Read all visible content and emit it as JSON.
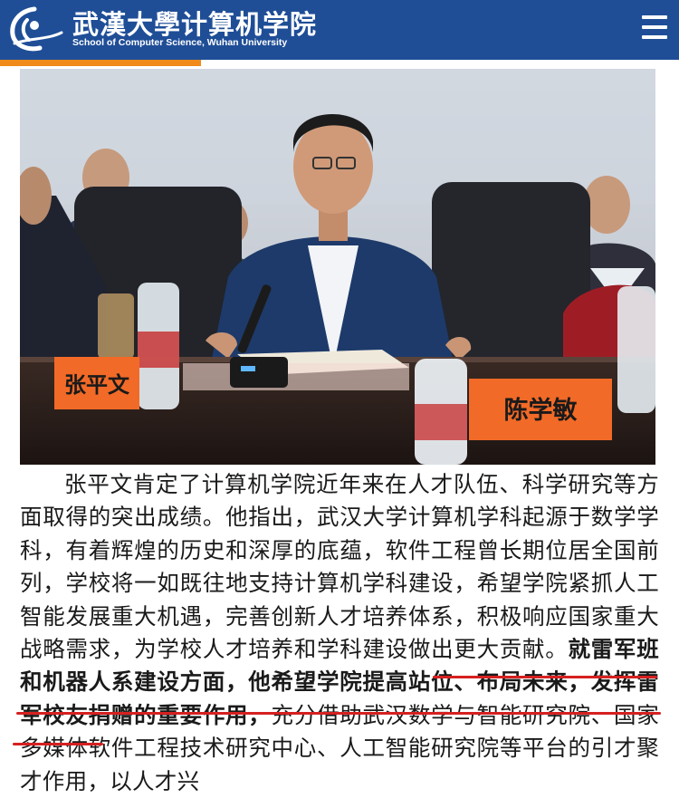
{
  "header": {
    "title_cn": "武漢大學计算机学院",
    "title_en": "School of Computer Science, Wuhan University",
    "emblem_icon": "wuhan-university-emblem-icon",
    "menu_icon": "hamburger-menu-icon",
    "bg_color": "#1f4e97",
    "accent_color": "#f08a1a"
  },
  "photo": {
    "nameplate_left": "张平文",
    "nameplate_right": "陈学敏"
  },
  "article": {
    "paragraph_start": "张平文肯定了计算机学院近年来在人才队伍、科学研究等方面取得的突出成绩。他指出，武汉大学计算机学科起源于数学学科，有着辉煌的历史和深厚的底蕴，软件工程曾长期位居全国前列，学校将一如既往地支持计算机学科建设，希望学院紧抓人工智能发展重大机遇，完善创新人才培养体系，积极响应国家重大战略需求，为学校人才培养和学科建设做出更大贡献。",
    "highlight": "就雷军班和机器人系建设方面，他希望学院提高站位、布局未来，发挥雷军校友捐赠的重要作用，",
    "paragraph_end": "充分借助武汉数学与智能研究院、国家多媒体软件工程技术研究中心、人工智能研究院等平台的引才聚才作用，以人才兴",
    "underline_color": "#d62020"
  }
}
